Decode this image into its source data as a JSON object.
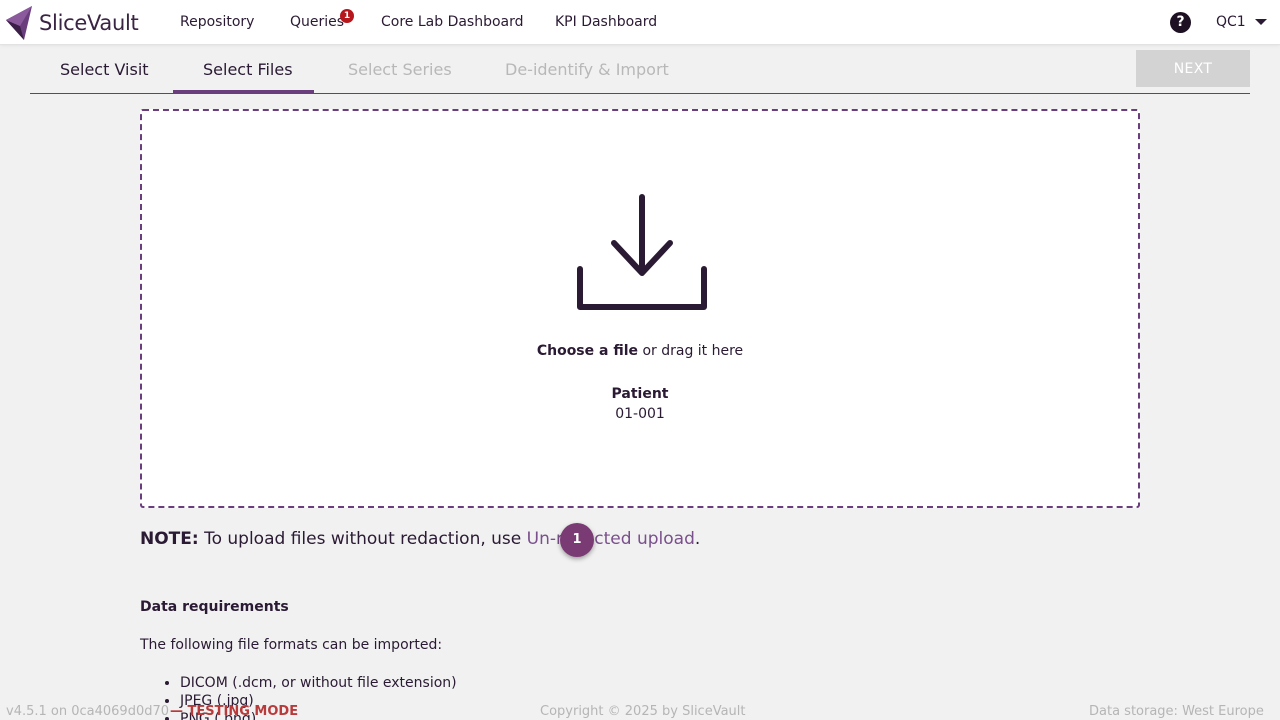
{
  "app": {
    "logo_text": "SliceVault",
    "brand_color": "#6a3d7c"
  },
  "nav": {
    "items": [
      {
        "label": "Repository"
      },
      {
        "label": "Queries",
        "badge": "1"
      },
      {
        "label": "Core Lab Dashboard"
      },
      {
        "label": "KPI Dashboard"
      }
    ],
    "help_icon": "question-circle-icon",
    "help_glyph": "?",
    "user": "QC1"
  },
  "stepper": {
    "steps": [
      {
        "label": "Select Visit",
        "state": "done"
      },
      {
        "label": "Select Files",
        "state": "active"
      },
      {
        "label": "Select Series",
        "state": "disabled"
      },
      {
        "label": "De-identify & Import",
        "state": "disabled"
      }
    ],
    "next_label": "NEXT"
  },
  "dropzone": {
    "icon": "download-icon",
    "choose_label": "Choose a file",
    "drag_text": " or drag it here",
    "patient_label": "Patient",
    "patient_id": "01-001"
  },
  "note": {
    "prefix": "NOTE:",
    "text": " To upload files without redaction, use ",
    "link": "Un-redacted upload",
    "suffix": ".",
    "marker": "1"
  },
  "requirements": {
    "heading": "Data requirements",
    "intro": "The following file formats can be imported:",
    "formats": [
      "DICOM (.dcm, or without file extension)",
      "JPEG (.jpg)",
      "PNG (.png)"
    ]
  },
  "footer": {
    "version": "v4.5.1 on 0ca4069d0d70",
    "mode": "— TESTING MODE",
    "copyright": "Copyright © 2025 by SliceVault",
    "storage": "Data storage: West Europe"
  }
}
